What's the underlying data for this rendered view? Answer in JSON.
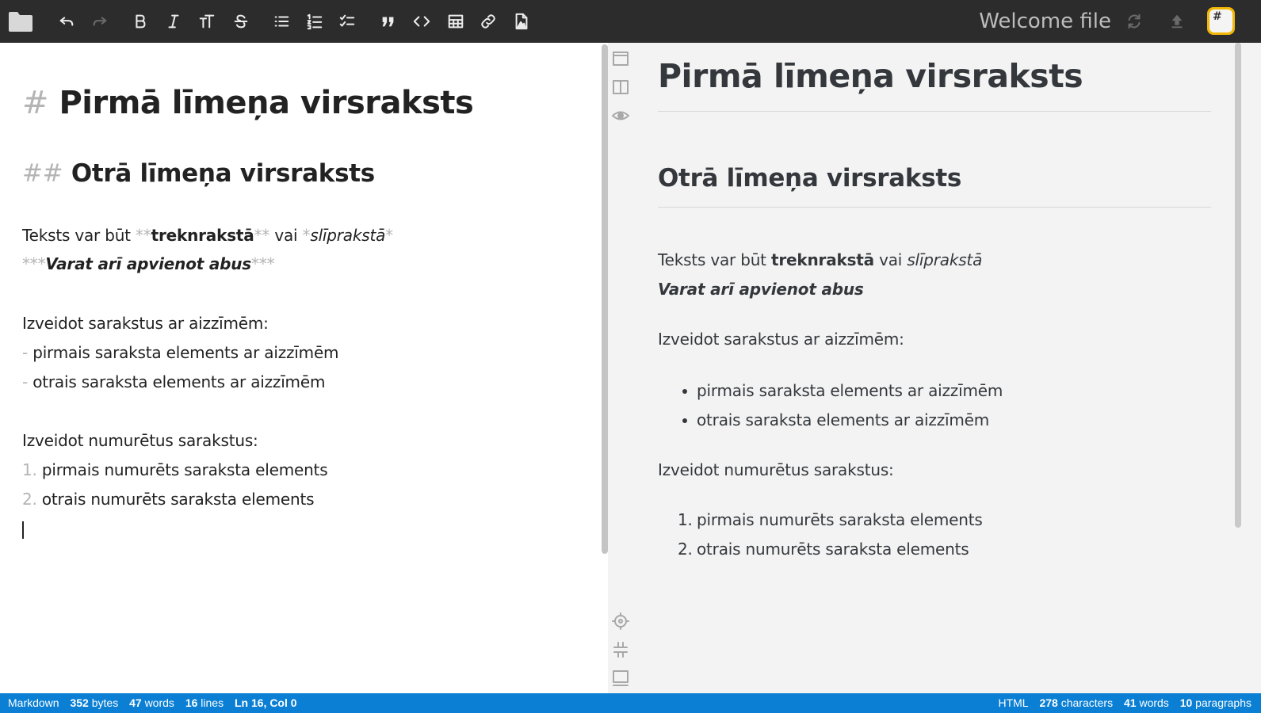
{
  "topbar": {
    "doc_title": "Welcome file",
    "badge_glyph": "#",
    "badge_color": "#f2b705",
    "icons": [
      "folder-icon",
      "undo-icon",
      "redo-icon",
      "bold-icon",
      "italic-icon",
      "heading-icon",
      "strikethrough-icon",
      "bulleted-list-icon",
      "numbered-list-icon",
      "checklist-icon",
      "quote-icon",
      "code-icon",
      "table-icon",
      "link-icon",
      "image-icon",
      "sync-icon",
      "publish-icon"
    ]
  },
  "editor": {
    "h1_marker": "#",
    "h1_text": "Pirmā līmeņa virsraksts",
    "h2_marker": "##",
    "h2_text": "Otrā līmeņa virsraksts",
    "line1_prefix": "Teksts var būt ",
    "bold_marker": "**",
    "bold_text": "treknrakstā",
    "line1_mid": " vai ",
    "italic_marker": "*",
    "italic_text": "slīprakstā",
    "bold_italic_marker": "***",
    "bold_italic_text": "Varat arī apvienot abus",
    "bullets_intro": "Izveidot sarakstus ar aizzīmēm:",
    "bullet_marker": "-",
    "bullets": [
      "pirmais saraksta elements ar aizzīmēm",
      "otrais saraksta elements ar aizzīmēm"
    ],
    "numbered_intro": "Izveidot numurētus sarakstus:",
    "numbered_markers": [
      "1.",
      "2."
    ],
    "numbered": [
      "pirmais numurēts saraksta elements",
      "otrais numurēts saraksta elements"
    ]
  },
  "preview": {
    "h1": "Pirmā līmeņa virsraksts",
    "h2": "Otrā līmeņa virsraksts",
    "p1_prefix": "Teksts var būt ",
    "p1_bold": "treknrakstā",
    "p1_mid": " vai ",
    "p1_italic": "slīprakstā",
    "p2_bold_italic": "Varat arī apvienot abus",
    "bullets_intro": "Izveidot sarakstus ar aizzīmēm:",
    "bullets": [
      "pirmais saraksta elements ar aizzīmēm",
      "otrais saraksta elements ar aizzīmēm"
    ],
    "numbered_intro": "Izveidot numurētus sarakstus:",
    "numbered_labels": [
      "1.",
      "2."
    ],
    "numbered": [
      "pirmais numurēts saraksta elements",
      "otrais numurēts saraksta elements"
    ],
    "side_icons": [
      "hide-preview-icon",
      "side-by-side-icon",
      "preview-mode-icon",
      "scroll-sync-icon",
      "toggle-navigation-icon",
      "toggle-statusbar-icon"
    ]
  },
  "statusbar": {
    "color": "#0a7fd4",
    "left": {
      "mode": "Markdown",
      "bytes": "352",
      "bytes_label": "bytes",
      "words": "47",
      "words_label": "words",
      "lines": "16",
      "lines_label": "lines",
      "cursor": "Ln 16, Col 0"
    },
    "right": {
      "mode": "HTML",
      "characters": "278",
      "characters_label": "characters",
      "words": "41",
      "words_label": "words",
      "paragraphs": "10",
      "paragraphs_label": "paragraphs"
    }
  }
}
